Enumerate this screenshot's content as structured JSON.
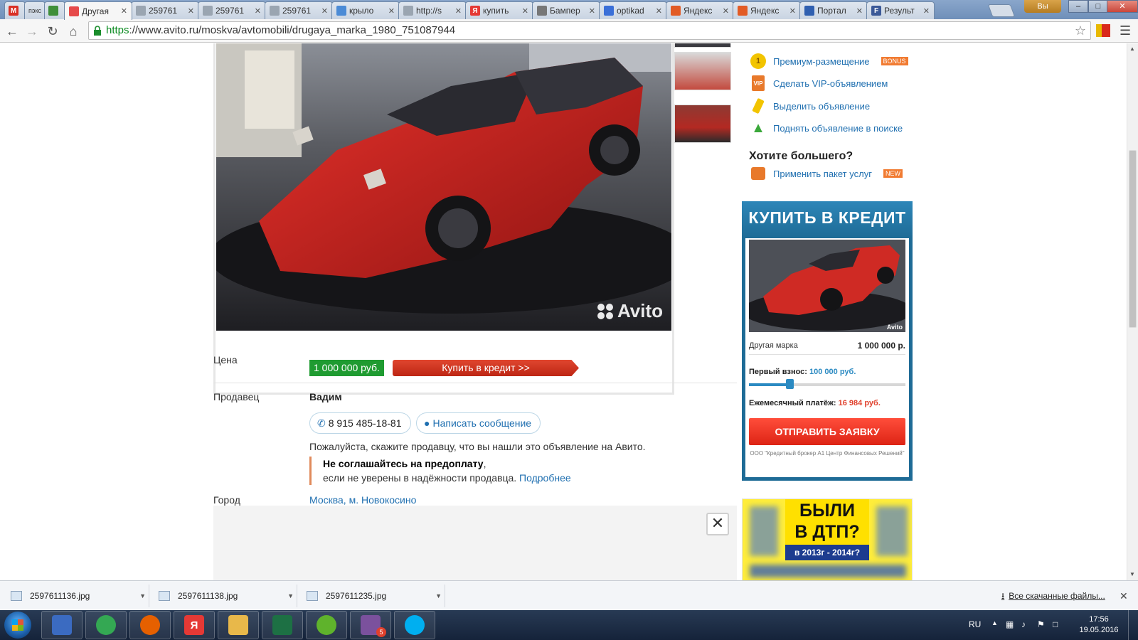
{
  "browser": {
    "tabs": [
      {
        "label": "",
        "icon": "gmail-icon",
        "color": "#d93025",
        "glyph": "M",
        "small": true
      },
      {
        "label": "пэкс",
        "icon": "site-icon",
        "color": "#5c7fa8",
        "glyph": "",
        "small": true
      },
      {
        "label": "",
        "icon": "emblem-icon",
        "color": "#3f8f3a",
        "glyph": "",
        "small": true
      },
      {
        "label": "Другая",
        "icon": "avito-icon",
        "color": "#e64a4a",
        "glyph": "",
        "active": true
      },
      {
        "label": "259761",
        "icon": "page-icon",
        "color": "#9aa5b1",
        "glyph": ""
      },
      {
        "label": "259761",
        "icon": "page-icon",
        "color": "#9aa5b1",
        "glyph": ""
      },
      {
        "label": "259761",
        "icon": "page-icon",
        "color": "#9aa5b1",
        "glyph": ""
      },
      {
        "label": "крыло",
        "icon": "avito-icon",
        "color": "#4b8bd6",
        "glyph": ""
      },
      {
        "label": "http://s",
        "icon": "page-icon",
        "color": "#9aa5b1",
        "glyph": ""
      },
      {
        "label": "купить",
        "icon": "yandex-icon",
        "color": "#e53935",
        "glyph": "Я"
      },
      {
        "label": "Бампер",
        "icon": "site-icon",
        "color": "#777",
        "glyph": ""
      },
      {
        "label": "optikad",
        "icon": "site-icon",
        "color": "#3a6fd8",
        "glyph": ""
      },
      {
        "label": "Яндекс",
        "icon": "yandex-icon",
        "color": "#e25b25",
        "glyph": ""
      },
      {
        "label": "Яндекс",
        "icon": "yandex-icon",
        "color": "#e25b25",
        "glyph": ""
      },
      {
        "label": "Портал",
        "icon": "portal-icon",
        "color": "#2f5fb0",
        "glyph": ""
      },
      {
        "label": "Результ",
        "icon": "facebook-icon",
        "color": "#3b5998",
        "glyph": "F"
      }
    ],
    "user_button": "Вы",
    "url_scheme": "https",
    "url_rest": "://www.avito.ru/moskva/avtomobili/drugaya_marka_1980_751087944"
  },
  "listing": {
    "watermark": "Avito",
    "price_label": "Цена",
    "price": "1 000 000 руб.",
    "credit_button": "Купить в кредит >>",
    "seller_label": "Продавец",
    "seller_name": "Вадим",
    "phone": "8 915 485-18-81",
    "message_button": "Написать сообщение",
    "hint": "Пожалуйста, скажите продавцу, что вы нашли это объявление на Авито.",
    "warn_bold": "Не соглашайтесь на предоплату",
    "warn_comma": ",",
    "warn_text": "если не уверены в надёжности продавца.",
    "warn_link": "Подробнее",
    "city_label": "Город",
    "city": "Москва, м. Новокосино"
  },
  "sidebar": {
    "services": [
      {
        "label": "Премиум-размещение",
        "badge": "BONUS",
        "icon": "coin-icon"
      },
      {
        "label": "Сделать VIP-объявлением",
        "badge": "",
        "icon": "vip-icon"
      },
      {
        "label": "Выделить объявление",
        "badge": "",
        "icon": "highlighter-icon"
      },
      {
        "label": "Поднять объявление в поиске",
        "badge": "",
        "icon": "arrow-up-icon"
      }
    ],
    "more_title": "Хотите большего?",
    "package": {
      "label": "Применить пакет услуг",
      "badge": "NEW"
    }
  },
  "credit_widget": {
    "title": "КУПИТЬ В КРЕДИТ",
    "photo_watermark": "Avito",
    "car_label": "Другая марка",
    "car_price": "1 000 000 р.",
    "down_label": "Первый взнос:",
    "down_value": "100 000 руб.",
    "down_fraction": 0.1,
    "monthly_label": "Ежемесячный платёж:",
    "monthly_value": "16 984 руб.",
    "submit": "ОТПРАВИТЬ ЗАЯВКУ",
    "footer": "ООО \"Кредитный брокер А1 Центр Финансовых Решений\""
  },
  "ad": {
    "line1": "БЫЛИ",
    "line2": "В ДТП?",
    "line3": "в 2013г - 2014г?"
  },
  "downloads": {
    "items": [
      "2597611136.jpg",
      "2597611138.jpg",
      "2597611235.jpg"
    ],
    "all_link": "Все скачанные файлы..."
  },
  "taskbar": {
    "lang": "RU",
    "time": "17:56",
    "date": "19.05.2016",
    "viber_badge": "5",
    "yandex_glyph": "Я",
    "apps": [
      {
        "name": "remote-desktop-icon",
        "color": "#3b6bc1"
      },
      {
        "name": "chrome-icon",
        "color": "#34a853"
      },
      {
        "name": "firefox-icon",
        "color": "#e66000"
      },
      {
        "name": "yandex-browser-icon",
        "color": "#e53935"
      },
      {
        "name": "explorer-icon",
        "color": "#e8b84a"
      },
      {
        "name": "excel-icon",
        "color": "#1d7044"
      },
      {
        "name": "icq-icon",
        "color": "#5fb32c"
      },
      {
        "name": "viber-icon",
        "color": "#7b519d"
      },
      {
        "name": "skype-icon",
        "color": "#00aff0"
      }
    ]
  }
}
